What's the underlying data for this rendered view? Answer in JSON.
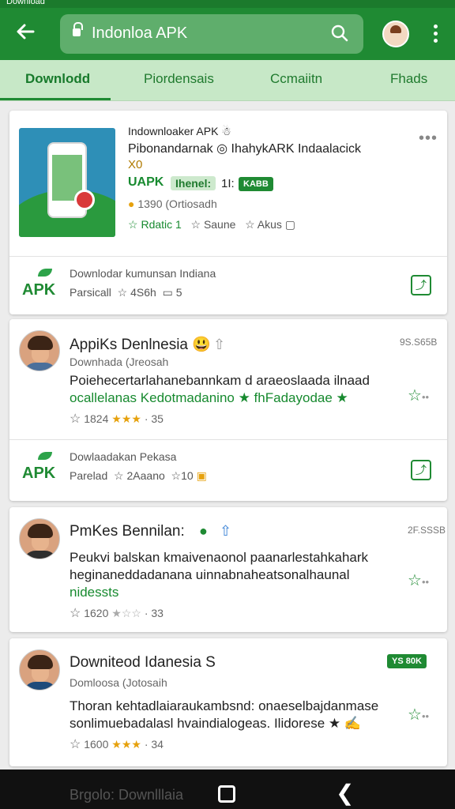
{
  "status_bar": {
    "left": "Download",
    "right_icons": [
      "wifi",
      "signal",
      "battery"
    ]
  },
  "appbar": {
    "search_text": "Indonloa APK",
    "icons": [
      "back-arrow-icon",
      "lock-icon",
      "search-icon",
      "avatar",
      "more-vert-icon"
    ]
  },
  "tabs": [
    "Downlodd",
    "Piordensais",
    "Ccmaiitn",
    "Fhads"
  ],
  "featured": {
    "line1": "Indownloaker APK ☃",
    "line2": "Pibonandarnak ◎ IhahykARK Indaalacick",
    "line3": "X0",
    "title": "UAPK",
    "pill": "Ihenel:",
    "count": "1I:",
    "chip": "KABB",
    "meta": "1390 (Ortiosadh",
    "actions": [
      "Rdatic 1",
      "Saune",
      "Akus"
    ],
    "menu": "•••",
    "bottom": {
      "logo": "APK",
      "line1": "Downlodar kumunsan Indiana",
      "line2a": "Parsicall",
      "line2b": "4S6h",
      "line2c": "5"
    }
  },
  "posts": [
    {
      "name": "AppiKs Denlnesia 😃",
      "time": "9S.S65B",
      "sub": "Downhada (Jreosah",
      "body1": "Poiehecertarlahanebannkam d araeoslaada ilnaad",
      "body2": "ocallelanas Kedotmadanino ★ fhFadayodae ★",
      "count": "1824",
      "stars": "★★★",
      "comments": "35",
      "bottom": {
        "logo": "APK",
        "line1": "Dowlaadakan Pekasa",
        "line2a": "Parelad",
        "line2b": "2Aaano",
        "line2c": "10"
      }
    },
    {
      "name": "PmKes Bennilan:",
      "time": "2F.SSSB",
      "sub": "",
      "body1": "Peukvi balskan kmaivenaonol paanarlestahkahark",
      "body2": "heginaneddadanana uinnabnaheatsonalhaunal",
      "body3": "nidessts",
      "count": "1620",
      "stars": "★☆☆",
      "comments": "33"
    },
    {
      "name": "Downiteod Idanesia S",
      "chip": "YS 80K",
      "sub": "Domloosa (Jotosaih",
      "body1": "Thoran kehtadlaiaraukambsnd: onaeselbajdanmase",
      "body2": "sonlimuebadalasl hvaindialogeas. Ilidorese ★ ✍",
      "count": "1600",
      "stars": "★★★",
      "comments": "34"
    }
  ],
  "peek": {
    "text": "Brgolo: Downlllaia"
  },
  "colors": {
    "primary": "#1f8a33",
    "tab_bg": "#c7e8c7",
    "gold": "#e6a10d"
  }
}
